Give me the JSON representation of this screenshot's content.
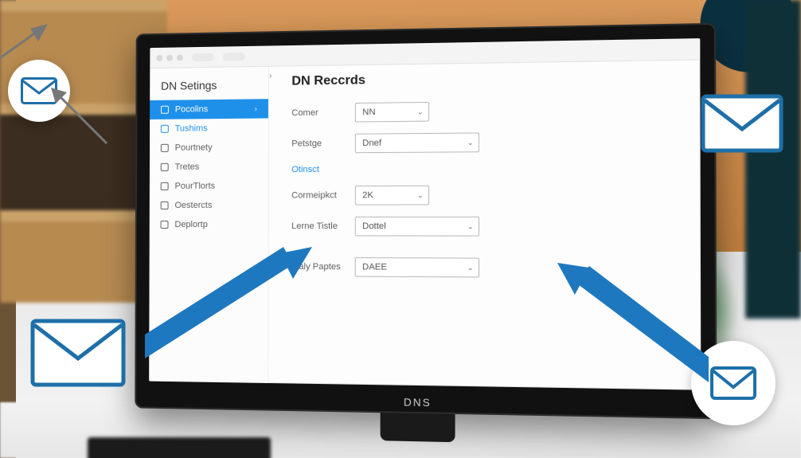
{
  "colors": {
    "accent": "#1e90ea",
    "icon_stroke": "#1e6fa8"
  },
  "monitor": {
    "brand": "DNS"
  },
  "titlebar": {
    "dots": 3
  },
  "sidebar": {
    "title": "DN Setings",
    "items": [
      {
        "label": "Pocolins",
        "active": true
      },
      {
        "label": "Tushims"
      },
      {
        "label": "Pourtnety"
      },
      {
        "label": "Tretes"
      },
      {
        "label": "PourTlorts"
      },
      {
        "label": "Oestercts"
      },
      {
        "label": "Deplortp"
      }
    ]
  },
  "breadcrumb": "›",
  "page": {
    "title": "DN Reccrds"
  },
  "form": {
    "rows": [
      {
        "label": "Comer",
        "value": "NN",
        "size": "sm"
      },
      {
        "label": "Petstge",
        "value": "Dnef",
        "size": "lg"
      },
      {
        "label": "Otinsct",
        "link": true
      },
      {
        "label": "Cormeipkct",
        "value": "2K",
        "size": "sm"
      },
      {
        "label": "Lerne Tistle",
        "value": "Dottel",
        "size": "lg"
      },
      {
        "label": "Tlaly Paptes",
        "value": "DAEE",
        "size": "lg"
      }
    ]
  }
}
